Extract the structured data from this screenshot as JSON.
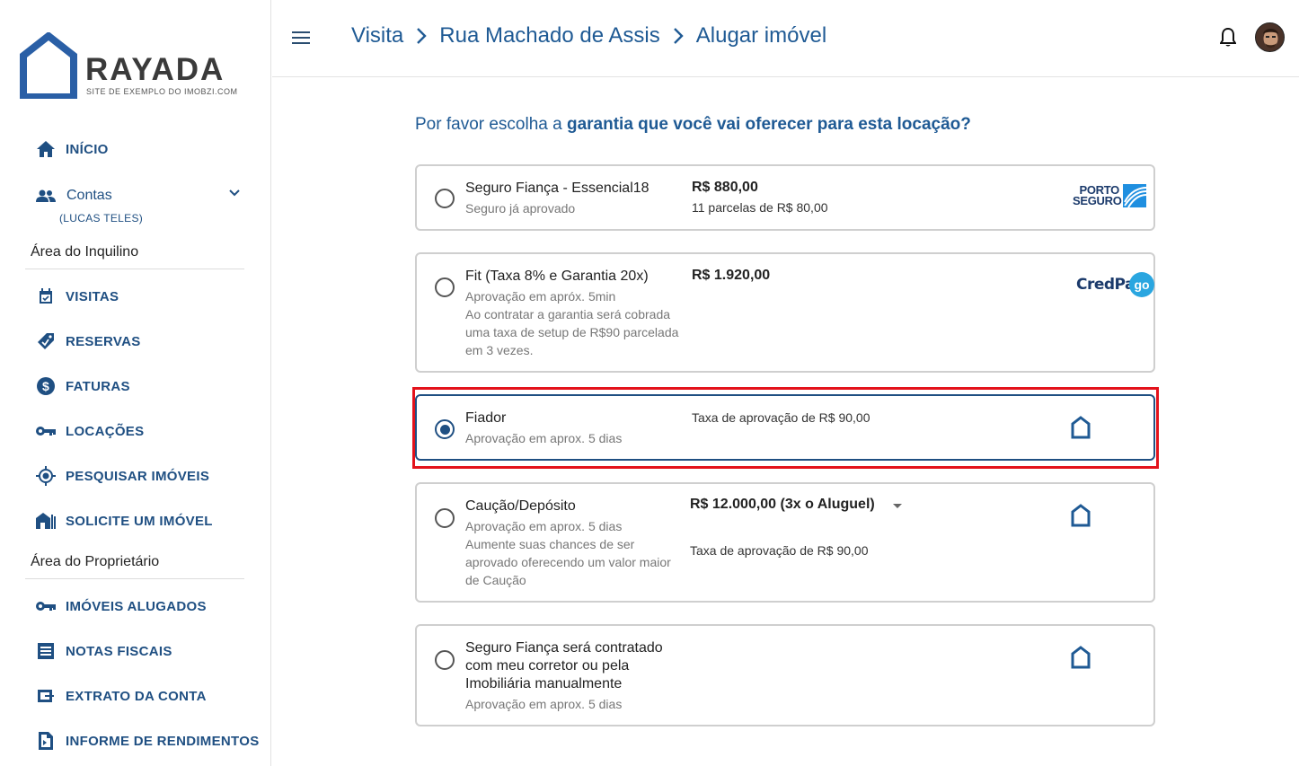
{
  "brand": {
    "name": "RAYADA",
    "tagline": "SITE DE EXEMPLO DO IMOBZI.COM"
  },
  "sidebar": {
    "inicio": "INÍCIO",
    "contas": {
      "label": "Contas",
      "user": "(LUCAS TELES)"
    },
    "tenant_section": "Área do Inquilino",
    "tenant_items": [
      {
        "label": "VISITAS",
        "icon": "calendar-check-icon"
      },
      {
        "label": "RESERVAS",
        "icon": "tag-check-icon"
      },
      {
        "label": "FATURAS",
        "icon": "dollar-circle-icon"
      },
      {
        "label": "LOCAÇÕES",
        "icon": "key-icon"
      },
      {
        "label": "PESQUISAR IMÓVEIS",
        "icon": "crosshair-icon"
      },
      {
        "label": "SOLICITE UM IMÓVEL",
        "icon": "house-search-icon"
      }
    ],
    "owner_section": "Área do Proprietário",
    "owner_items": [
      {
        "label": "IMÓVEIS ALUGADOS",
        "icon": "key-icon"
      },
      {
        "label": "NOTAS FISCAIS",
        "icon": "list-box-icon"
      },
      {
        "label": "EXTRATO DA CONTA",
        "icon": "wallet-icon"
      },
      {
        "label": "INFORME DE RENDIMENTOS",
        "icon": "document-export-icon"
      }
    ]
  },
  "header": {
    "breadcrumbs": [
      "Visita",
      "Rua Machado de Assis",
      "Alugar imóvel"
    ]
  },
  "main": {
    "question_prefix": "Por favor escolha a ",
    "question_bold": "garantia que você vai oferecer para esta locação?",
    "options": [
      {
        "title": "Seguro Fiança - Essencial18",
        "desc": "Seguro já aprovado",
        "price": "R$ 880,00",
        "price_detail": "11 parcelas de R$ 80,00",
        "logo": "PORTO SEGURO",
        "selected": false
      },
      {
        "title": "Fit (Taxa 8% e Garantia 20x)",
        "desc": "Aprovação em apróx. 5min",
        "desc2": "Ao contratar a garantia será cobrada uma taxa de setup de R$90 parcelada em 3 vezes.",
        "price": "R$ 1.920,00",
        "logo_part1": "CredPa",
        "logo_part2": "go",
        "selected": false
      },
      {
        "title": "Fiador",
        "desc": "Aprovação em aprox. 5 dias",
        "price_detail": "Taxa de aprovação de R$ 90,00",
        "selected": true
      },
      {
        "title": "Caução/Depósito",
        "desc": "Aprovação em aprox. 5 dias",
        "desc2": "Aumente suas chances de ser aprovado oferecendo um valor maior de Caução",
        "price": "R$ 12.000,00 (3x o Aluguel)",
        "price_detail": "Taxa de aprovação de R$ 90,00",
        "selected": false
      },
      {
        "title": "Seguro Fiança será contratado com meu corretor ou pela Imobiliária manualmente",
        "desc": "Aprovação em aprox. 5 dias",
        "selected": false
      }
    ]
  },
  "colors": {
    "primary": "#1f4f82",
    "highlight": "#e3121b"
  }
}
